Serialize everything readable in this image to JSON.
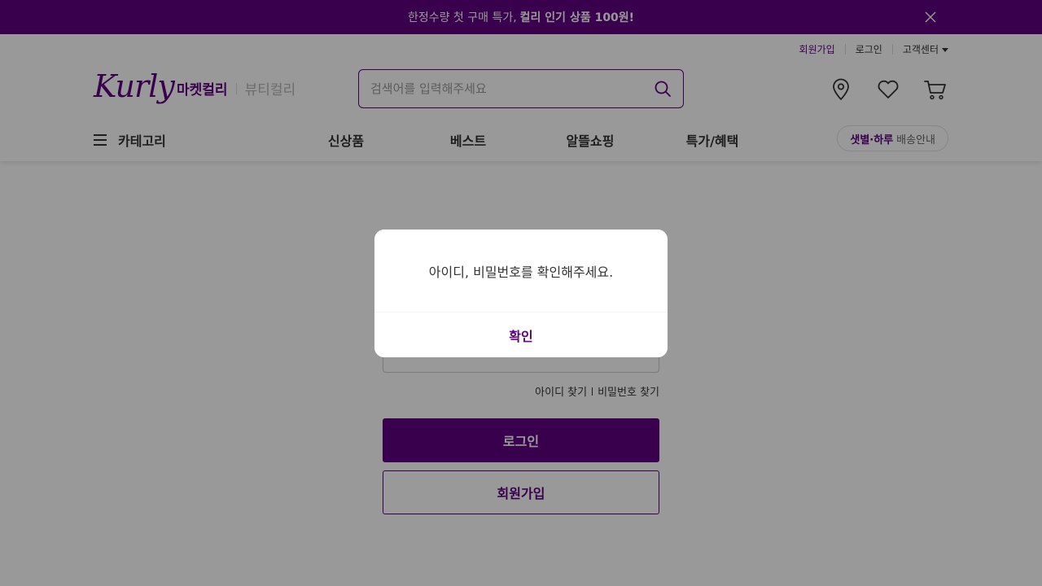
{
  "banner": {
    "text": "한정수량 첫 구매 특가,",
    "highlight": "컬리 인기 상품 100원!"
  },
  "user_menu": {
    "join": "회원가입",
    "login": "로그인",
    "support": "고객센터"
  },
  "header": {
    "logo": "Kurly",
    "mall_active": "마켓컬리",
    "mall_inactive": "뷰티컬리",
    "search_placeholder": "검색어를 입력해주세요"
  },
  "gnb": {
    "category": "카테고리",
    "menu": [
      "신상품",
      "베스트",
      "알뜰쇼핑",
      "특가/혜택"
    ],
    "delivery_highlight": "샛별·하루",
    "delivery_text": "배송안내"
  },
  "login_form": {
    "find_id": "아이디 찾기",
    "find_password": "비밀번호 찾기",
    "login_button": "로그인",
    "join_button": "회원가입"
  },
  "dialog": {
    "message": "아이디, 비밀번호를 확인해주세요.",
    "confirm": "확인"
  },
  "colors": {
    "brand": "#5f0080",
    "overlay": "rgba(0,0,0,0.4)"
  },
  "icons": [
    "close-icon",
    "search-icon",
    "location-icon",
    "heart-icon",
    "cart-icon",
    "menu-icon",
    "chevron-down-icon"
  ]
}
